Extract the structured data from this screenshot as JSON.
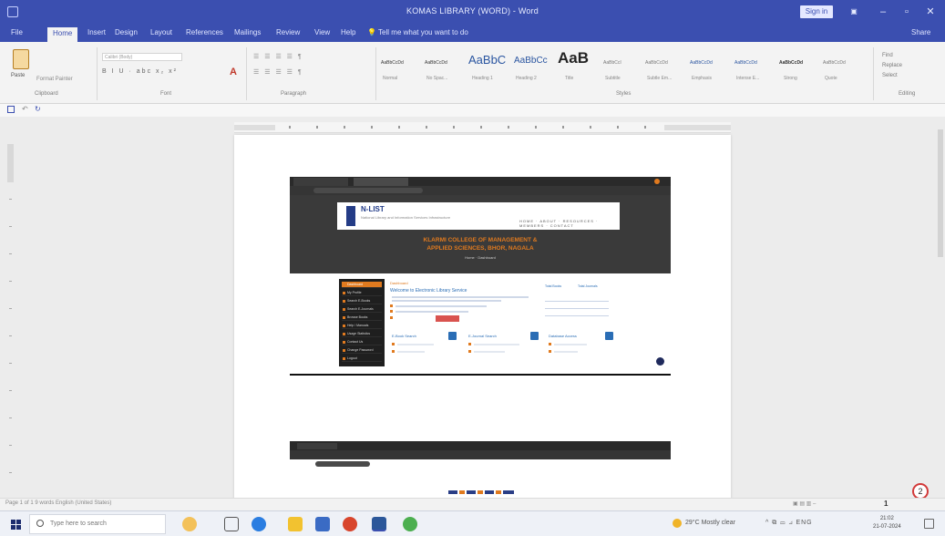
{
  "titlebar": {
    "title": "KOMAS LIBRARY (WORD) - Word",
    "sign_in": "Sign in",
    "minimize": "–",
    "maximize": "▫",
    "close": "✕"
  },
  "ribbon_tabs": [
    {
      "label": "File"
    },
    {
      "label": "Home"
    },
    {
      "label": "Insert"
    },
    {
      "label": "Design"
    },
    {
      "label": "Layout"
    },
    {
      "label": "References"
    },
    {
      "label": "Mailings"
    },
    {
      "label": "Review"
    },
    {
      "label": "View"
    },
    {
      "label": "Help"
    }
  ],
  "tell_me": "Tell me what you want to do",
  "share": "Share",
  "clipboard": {
    "paste": "Paste",
    "format_painter": "Format Painter",
    "group": "Clipboard"
  },
  "font": {
    "name": "Calibri (Body)",
    "tools": "B I U · abc x₂ x²",
    "color_glyph": "A",
    "group": "Font"
  },
  "paragraph": {
    "tools": "☰ ☰ ☰ ☰ ¶",
    "group": "Paragraph"
  },
  "styles": {
    "items": [
      {
        "preview": "AaBbCcDd",
        "label": "Normal"
      },
      {
        "preview": "AaBbCcDd",
        "label": "No Spac..."
      },
      {
        "preview": "AaBbC",
        "label": "Heading 1"
      },
      {
        "preview": "AaBbCc",
        "label": "Heading 2"
      },
      {
        "preview": "AaB",
        "label": "Title"
      },
      {
        "preview": "AaBbCcI",
        "label": "Subtitle"
      },
      {
        "preview": "AaBbCcDd",
        "label": "Subtle Em..."
      },
      {
        "preview": "AaBbCcDd",
        "label": "Emphasis"
      },
      {
        "preview": "AaBbCcDd",
        "label": "Intense E..."
      },
      {
        "preview": "AaBbCcDd",
        "label": "Strong"
      },
      {
        "preview": "AaBbCcDd",
        "label": "Quote"
      }
    ],
    "group": "Styles"
  },
  "editing": {
    "find": "Find",
    "replace": "Replace",
    "select": "Select",
    "group": "Editing"
  },
  "embedded_page": {
    "brand": "N-LIST",
    "brand_sub": "National Library and Information Services Infrastructure",
    "nav": "HOME · ABOUT · RESOURCES · MEMBERS · CONTACT",
    "college_line1": "KLARMI COLLEGE OF MANAGEMENT &",
    "college_line2": "APPLIED SCIENCES, BHOR, NAGALA",
    "college_sub": "Home · Dashboard",
    "side_items": [
      "Dashboard",
      "My Profile",
      "Search E-Books",
      "Search E-Journals",
      "Browse Books",
      "Help / Manuals",
      "Usage Statistics",
      "Contact Us",
      "Change Password",
      "Logout"
    ],
    "main_title": "Dashboard",
    "main_head": "Welcome to Electronic Library Service",
    "stat_a": "Total Books",
    "stat_b": "Total Journals",
    "cards": [
      {
        "title": "E-Book Search"
      },
      {
        "title": "E-Journal Search"
      },
      {
        "title": "Database Access"
      }
    ]
  },
  "help_badge": "2",
  "statusbar": {
    "left": "Page 1 of 1   9 words   English (United States)",
    "right": "▣ ▤ ▥  –",
    "zoom": "1"
  },
  "taskbar": {
    "search_placeholder": "Type here to search",
    "weather": "29°C  Mostly clear",
    "tray": "^ ⧉ ▭ ⊿ ENG",
    "time": "21:02",
    "date": "21-07-2024"
  },
  "colors": {
    "word_blue": "#3b4fb0",
    "nlist_orange": "#e07a1f",
    "nlist_blue": "#2a6db5"
  }
}
